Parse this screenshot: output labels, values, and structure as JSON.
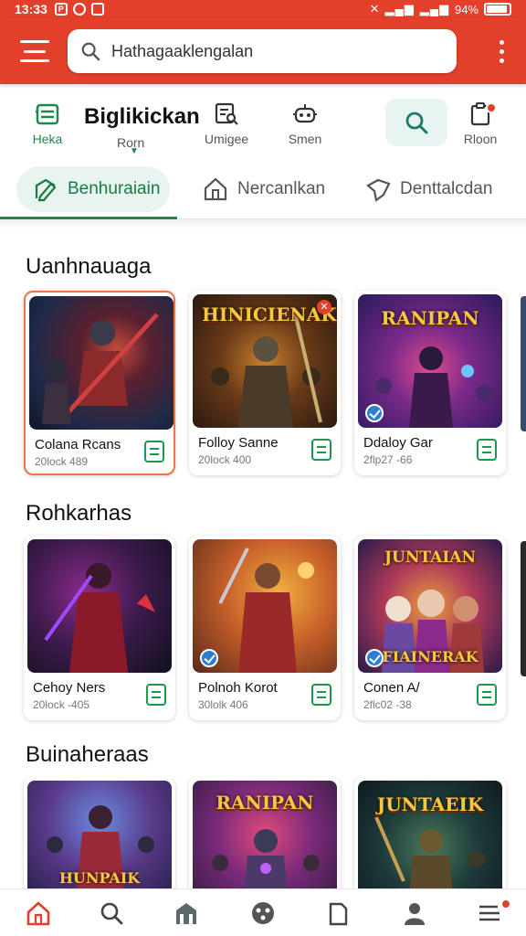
{
  "status_bar": {
    "time": "13:33",
    "battery": "94%"
  },
  "app_bar": {
    "search_value": "Hathagaaklengalan",
    "menu_icon": "hamburger-icon",
    "more_icon": "more-vert-icon"
  },
  "quick_nav": {
    "brand": "Biglikickan",
    "items": [
      {
        "label": "Heka",
        "icon": "list-icon"
      },
      {
        "label": "Rorn",
        "icon": "chevron-down-icon"
      },
      {
        "label": "Umigee",
        "icon": "edit-search-icon"
      },
      {
        "label": "Smen",
        "icon": "robot-icon"
      },
      {
        "label": "",
        "icon": "search-icon"
      },
      {
        "label": "Rloon",
        "icon": "clipboard-icon"
      }
    ]
  },
  "tabs": [
    {
      "label": "Benhuraiain",
      "icon": "edit-icon",
      "active": true
    },
    {
      "label": "Nercanlkan",
      "icon": "home-icon",
      "active": false
    },
    {
      "label": "Denttalcdan",
      "icon": "tag-icon",
      "active": false
    }
  ],
  "sections": [
    {
      "title": "Uanhnauaga",
      "cards": [
        {
          "title": "Colana Rcans",
          "subtitle": "20lock 489",
          "art_title": "",
          "badge": "none",
          "selected": true
        },
        {
          "title": "Folloy Sanne",
          "subtitle": "20lock 400",
          "art_title": "HINICIENAK",
          "badge": "close",
          "selected": false
        },
        {
          "title": "Ddaloy Gar",
          "subtitle": "2flp27 -66",
          "art_title": "RANIPAN",
          "badge": "check",
          "selected": false
        }
      ]
    },
    {
      "title": "Rohkarhas",
      "cards": [
        {
          "title": "Cehoy Ners",
          "subtitle": "20lock -405",
          "art_title": "",
          "badge": "none",
          "selected": false
        },
        {
          "title": "Polnoh Korot",
          "subtitle": "30lolk 406",
          "art_title": "",
          "badge": "check",
          "selected": false
        },
        {
          "title": "Conen A/",
          "subtitle": "2flc02 -38",
          "art_title": "JUNTAIAN",
          "art_title_bottom": "FIAINERAK",
          "badge": "check",
          "selected": false
        }
      ]
    },
    {
      "title": "Buinaheraas",
      "cards": [
        {
          "title": "",
          "subtitle": "",
          "art_title": "",
          "art_title_bottom": "HUNPAIK",
          "badge": "none",
          "selected": false
        },
        {
          "title": "",
          "subtitle": "",
          "art_title": "RANIPAN",
          "badge": "none",
          "selected": false
        },
        {
          "title": "",
          "subtitle": "",
          "art_title": "JUNTAEIK",
          "badge": "none",
          "selected": false
        }
      ]
    }
  ],
  "bottom_nav": [
    {
      "icon": "home-icon",
      "active": true
    },
    {
      "icon": "search-icon",
      "active": false
    },
    {
      "icon": "store-icon",
      "active": false
    },
    {
      "icon": "gamepad-icon",
      "active": false
    },
    {
      "icon": "library-icon",
      "active": false
    },
    {
      "icon": "profile-icon",
      "active": false
    },
    {
      "icon": "menu-icon",
      "active": false
    }
  ],
  "colors": {
    "brand_red": "#e2402a",
    "accent_green": "#1a8a4a",
    "tab_active_bg": "#e7f4ef"
  }
}
